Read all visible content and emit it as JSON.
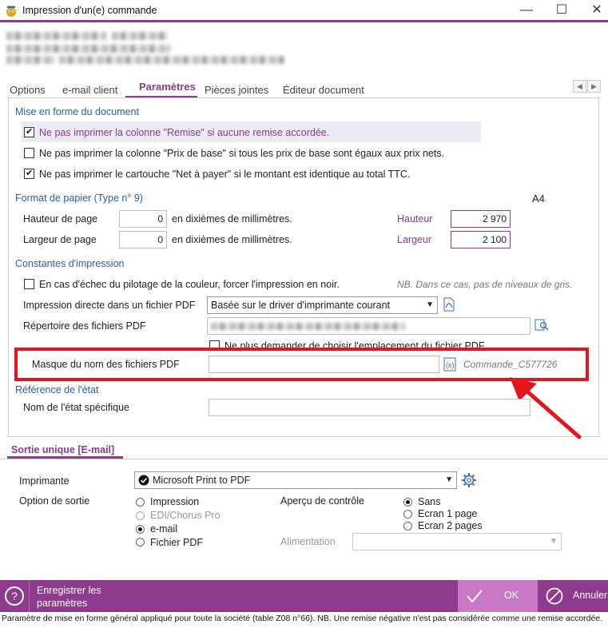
{
  "window": {
    "title": "Impression d'un(e) commande"
  },
  "tabs": [
    {
      "label": "Options"
    },
    {
      "label": "e-mail client"
    },
    {
      "label": "Paramètres"
    },
    {
      "label": "Pièces jointes"
    },
    {
      "label": "Éditeur document"
    }
  ],
  "mise_en_forme": {
    "heading": "Mise en forme du document",
    "items": [
      {
        "label": "Ne pas imprimer la colonne \"Remise\" si aucune remise accordée.",
        "checked": true
      },
      {
        "label": "Ne pas imprimer la colonne \"Prix de base\" si tous les prix de base sont égaux aux prix nets.",
        "checked": false
      },
      {
        "label": "Ne pas imprimer le cartouche \"Net à payer\" si le montant est identique au total TTC.",
        "checked": true
      }
    ]
  },
  "format_papier": {
    "heading": "Format de papier (Type n° 9)",
    "format_name": "A4",
    "hauteur_label": "Hauteur de page",
    "hauteur_value": "0",
    "largeur_label": "Largeur de page",
    "largeur_value": "0",
    "unit_label": "en dixièmes de millimètres.",
    "hauteur_ref_label": "Hauteur",
    "hauteur_ref_value": "2 970",
    "largeur_ref_label": "Largeur",
    "largeur_ref_value": "2 100"
  },
  "constantes": {
    "heading": "Constantes d'impression",
    "noir_label": "En cas d'échec du pilotage de la couleur, forcer l'impression en noir.",
    "noir_note": "NB. Dans ce cas, pas de niveaux de gris.",
    "pdf_direct_label": "Impression directe dans un fichier PDF",
    "pdf_direct_value": "Basée sur le driver d'imprimante courant",
    "repertoire_label": "Répertoire des fichiers PDF",
    "ne_plus_demander_label": "Ne plus demander de choisir l'emplacement du fichier PDF",
    "masque_label": "Masque du nom des fichiers PDF",
    "masque_value": "",
    "masque_preview": "Commande_C577726"
  },
  "reference": {
    "heading": "Référence de l'état",
    "nom_label": "Nom de l'état spécifique",
    "nom_value": ""
  },
  "sortie": {
    "tab_label": "Sortie unique [E-mail]",
    "imprimante_label": "Imprimante",
    "imprimante_value": "Microsoft Print to PDF",
    "option_label": "Option de sortie",
    "options": [
      {
        "label": "Impression",
        "checked": false,
        "disabled": false
      },
      {
        "label": "EDI/Chorus Pro",
        "checked": false,
        "disabled": true
      },
      {
        "label": "e-mail",
        "checked": true,
        "disabled": false
      },
      {
        "label": "Fichier PDF",
        "checked": false,
        "disabled": false
      }
    ],
    "apercu_label": "Aperçu de contrôle",
    "apercu_options": [
      {
        "label": "Sans",
        "checked": true
      },
      {
        "label": "Ecran 1 page",
        "checked": false
      },
      {
        "label": "Ecran 2 pages",
        "checked": false
      }
    ],
    "alimentation_label": "Alimentation",
    "alimentation_value": ""
  },
  "footer": {
    "help": "?",
    "save_label": "Enregistrer les paramètres",
    "ok_label": "OK",
    "cancel_label": "Annuler"
  },
  "statusbar": {
    "text": "Paramètre de mise en forme général appliqué pour toute la société (table Z08 n°66). NB. Une remise négative n'est pas considérée comme une remise accordée."
  },
  "colors": {
    "accent": "#8e3a8e",
    "ok_background": "#c978c6",
    "highlight_box": "#e8141c",
    "section_heading": "#2b5fa8"
  }
}
